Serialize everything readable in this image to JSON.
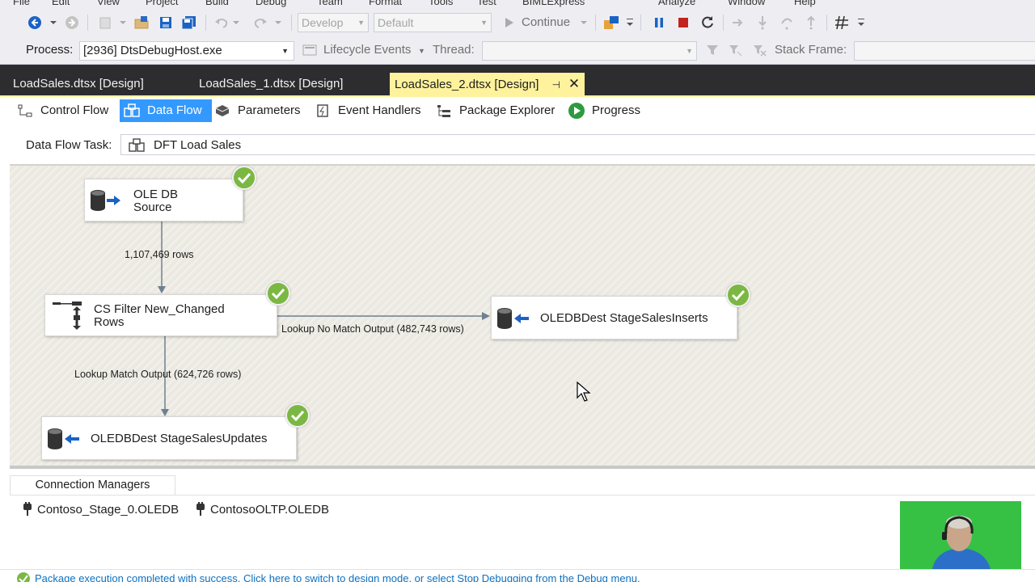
{
  "menu": {
    "items": [
      "File",
      "Edit",
      "View",
      "Project",
      "Build",
      "Debug",
      "Team",
      "Format",
      "Tools",
      "Test",
      "BIMLExpress",
      "Analyze",
      "Window",
      "Help"
    ]
  },
  "toolbar": {
    "solution_config": "Develop",
    "solution_platform": "Default",
    "continue_label": "Continue"
  },
  "debug_bar": {
    "process_label": "Process:",
    "process_value": "[2936] DtsDebugHost.exe",
    "lifecycle_label": "Lifecycle Events",
    "thread_label": "Thread:",
    "stack_frame_label": "Stack Frame:"
  },
  "doc_tabs": [
    {
      "label": "LoadSales.dtsx [Design]"
    },
    {
      "label": "LoadSales_1.dtsx [Design]"
    },
    {
      "label": "LoadSales_2.dtsx [Design]"
    }
  ],
  "designer_tabs": [
    {
      "label": "Control Flow"
    },
    {
      "label": "Data Flow"
    },
    {
      "label": "Parameters"
    },
    {
      "label": "Event Handlers"
    },
    {
      "label": "Package Explorer"
    },
    {
      "label": "Progress"
    }
  ],
  "task": {
    "label": "Data Flow Task:",
    "value": "DFT Load Sales"
  },
  "nodes": {
    "source": {
      "line1": "OLE DB",
      "line2": "Source"
    },
    "filter": {
      "line1": "CS Filter New_Changed",
      "line2": "Rows"
    },
    "inserts": {
      "label": "OLEDBDest StageSalesInserts"
    },
    "updates": {
      "label": "OLEDBDest StageSalesUpdates"
    }
  },
  "paths": {
    "source_to_filter": "1,107,469 rows",
    "no_match": "Lookup No Match Output (482,743 rows)",
    "match": "Lookup Match Output (624,726 rows)"
  },
  "connection_managers": {
    "tab_label": "Connection Managers",
    "items": [
      "Contoso_Stage_0.OLEDB",
      "ContosoOLTP.OLEDB"
    ]
  },
  "status": {
    "text": "Package execution completed with success. Click here to switch to design mode, or select Stop Debugging from the Debug menu."
  },
  "colors": {
    "accent": "#3399ff",
    "active_tab": "#fff29d",
    "success": "#7bb843",
    "surface": "#ebe9e1"
  }
}
